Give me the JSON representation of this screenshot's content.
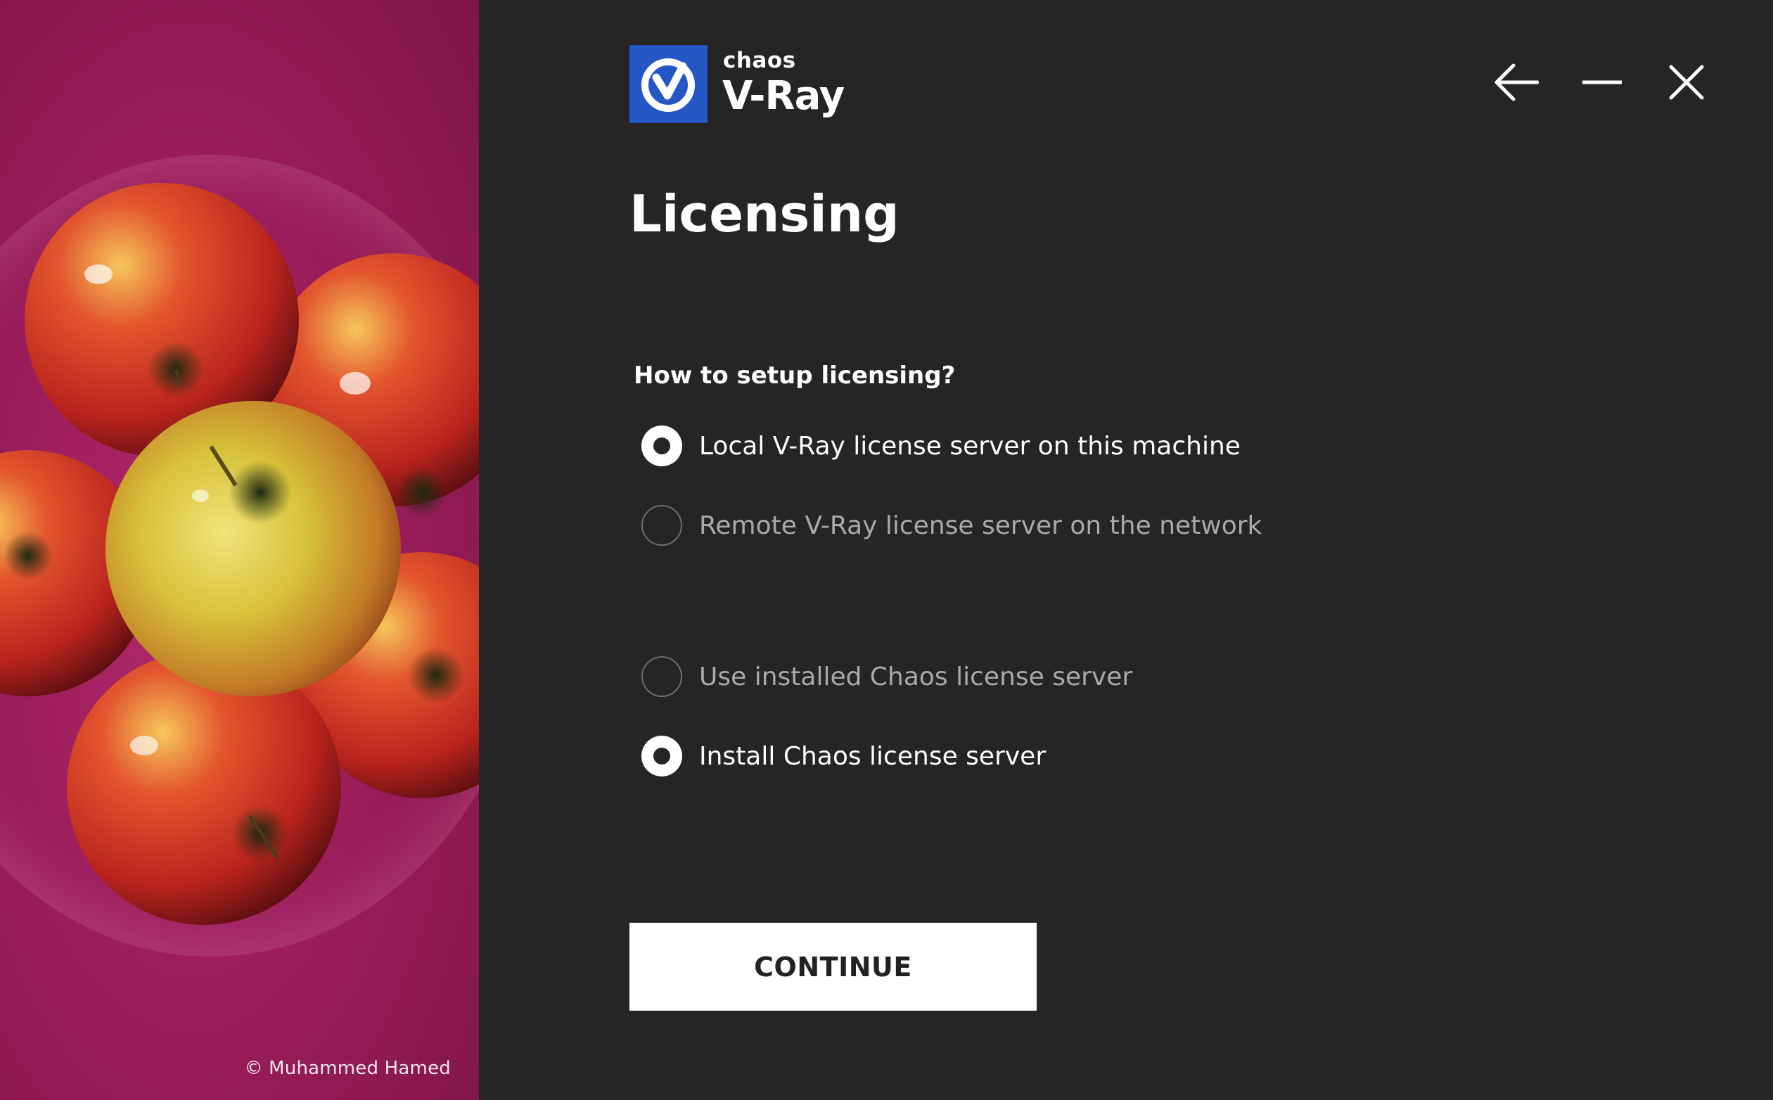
{
  "app": {
    "brand_small": "chaos",
    "brand_name": "V-Ray"
  },
  "window_controls": {
    "back_icon": "arrow-left-icon",
    "minimize_icon": "minimize-icon",
    "close_icon": "close-icon"
  },
  "page": {
    "title": "Licensing",
    "question": "How to setup licensing?"
  },
  "options": [
    {
      "label": "Local V-Ray license server on this machine",
      "selected": true
    },
    {
      "label": "Remote V-Ray license server on the network",
      "selected": false
    },
    {
      "label": "Use installed Chaos license server",
      "selected": false
    },
    {
      "label": "Install Chaos license server",
      "selected": true
    }
  ],
  "actions": {
    "continue_label": "CONTINUE"
  },
  "artwork": {
    "credit": "© Muhammed Hamed"
  },
  "colors": {
    "background": "#252525",
    "brand_blue": "#2456c4",
    "art_magenta": "#9c1d5c",
    "button_bg": "#ffffff"
  }
}
